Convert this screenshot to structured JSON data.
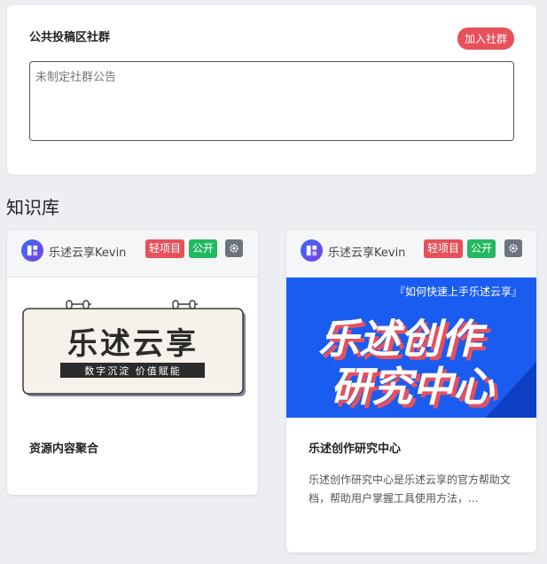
{
  "community": {
    "title": "公共投稿区社群",
    "join_label": "加入社群",
    "notice_placeholder": "未制定社群公告"
  },
  "knowledge": {
    "section_title": "知识库",
    "cards": [
      {
        "author": "乐述云享Kevin",
        "tag_type": "轻项目",
        "tag_visibility": "公开",
        "cover_title": "乐述云享",
        "cover_subtitle": "数字沉淀 价值赋能",
        "title": "资源内容聚合",
        "description": ""
      },
      {
        "author": "乐述云享Kevin",
        "tag_type": "轻项目",
        "tag_visibility": "公开",
        "cover_caption": "『如何快速上手乐述云享』",
        "cover_line1": "乐述创作",
        "cover_line2": "研究中心",
        "title": "乐述创作研究中心",
        "description": "乐述创作研究中心是乐述云享的官方帮助文档，帮助用户掌握工具使用方法，..."
      }
    ]
  },
  "colors": {
    "accent_red": "#e8505b",
    "accent_green": "#22b85f",
    "cover_blue": "#1a5cf0"
  },
  "icons": [
    "logo-icon",
    "gear-icon"
  ]
}
